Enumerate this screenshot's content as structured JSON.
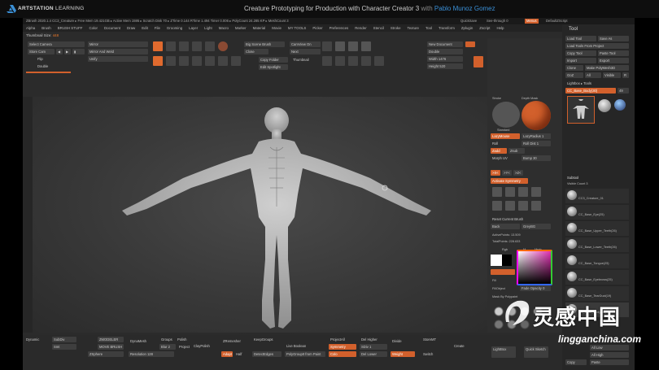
{
  "header": {
    "brand_bold": "ARTSTATION",
    "brand_rest": "LEARNING",
    "course_title": "Creature Prototyping for Production with Character Creator 3",
    "with": "with",
    "author": "Pablo Munoz Gomez"
  },
  "title_bar": {
    "info": "ZBrush 2020.1.4   CC3_Creature   ▸ Free Mem 19.421GB ▸ Active Mem 1595 ▸ Scratch Disk 70 ▸ ZTime 0.144 RTime 1.494 Timer 0.006 ▸ PolyCount 24.285 KP ▸ MeshCount 3",
    "quicksave": "QuickSave",
    "seethrough": "See-through  0",
    "menus": "Menus",
    "defaultzscript": "DefaultZScript"
  },
  "menu": [
    "Alpha",
    "Brush",
    "BRUSH STUFF",
    "Color",
    "Document",
    "Draw",
    "Edit",
    "File",
    "Grooming",
    "Layer",
    "Light",
    "Macro",
    "Marker",
    "Material",
    "Movie",
    "MY TOOLS",
    "Picker",
    "Preferences",
    "Render",
    "Stencil",
    "Stroke",
    "Texture",
    "Tool",
    "Transform",
    "Zplugin",
    "Zscript",
    "Help"
  ],
  "thumbnail": {
    "label": "Thumbnail Size:",
    "value": "448"
  },
  "top_left": {
    "select_camera": "Select Camera",
    "store_cam": "Store Cam",
    "flip": "Flip",
    "double": "Double",
    "mirror": "Mirror",
    "mirror_weld": "Mirror And Weld",
    "unify": "Unify"
  },
  "top_icons": {
    "edit": "Edit",
    "draw": "Draw",
    "move": "Move",
    "scale": "Scale",
    "rotate": "Rotate",
    "topo": "Topo",
    "polyf": "PolyF",
    "solo": "Solo",
    "bpr": "BPR",
    "lsym": "LSym",
    "sxyz": "XYZ",
    "frame": "Frame",
    "xpose": "Xpose",
    "local": "Local",
    "floor": "Floor"
  },
  "top_mid": {
    "big_scene": "Big Scene Brush",
    "close": "Close",
    "copy_folder": "Copy Folder",
    "edit_spotlight": "Edit Spotlight",
    "thumbnail": "Thumbnail",
    "cam_view": "CamView On",
    "next": "Next",
    "load_obj": "Load OBJ"
  },
  "doc": {
    "new_document": "New Document",
    "double": "Double",
    "width_label": "Width",
    "width": "1476",
    "height_label": "Height",
    "height": "520",
    "save": "Save",
    "projection": "Projection Master",
    "quick_render": "Quick Render Test",
    "bpr_label": "BPR",
    "render_sculpt": "Back To Sculpt",
    "repeat": "Repeat",
    "groups": "Groups By Materials"
  },
  "mid_panel": {
    "stroke": "Stroke",
    "depth_mask": "Depth Mask",
    "standard": "Standard",
    "lazy": "LazyMouse",
    "lazy_radius": "LazyRadius 1",
    "roll": "Roll",
    "roll_dist": "Roll Dist 1",
    "zadd": "Zadd",
    "zsub": "Zsub",
    "morph_uv": "Morph UV",
    "bump": "Bump 30",
    "activate_symmetry": "Activate Symmetry",
    "x": ">X<",
    "y": ">Y<",
    "z": ">Z<",
    "reset_brush": "Reset Current Brush",
    "back": "Back",
    "grey": "GreyBG",
    "active_points": "ActivePoints: 13.509",
    "total_points": "TotalPoints: 228.633",
    "rgb": "Rgb",
    "m": "M",
    "mrgb": "Mrgb",
    "fill": "Fill",
    "fill_object": "FillObject",
    "fade_opacity": "Fade Opacity 0",
    "mask_polypaint": "Mask By Polypaint"
  },
  "tool": {
    "title": "Tool",
    "load_tool": "Load Tool",
    "save_as": "Save As",
    "load_project": "Load Tools From Project",
    "copy_tool": "Copy Tool",
    "paste_tool": "Paste Tool",
    "import": "Import",
    "export": "Export",
    "clone": "Clone",
    "make_polymesh": "Make PolyMesh3D",
    "goz": "GoZ",
    "all": "All",
    "visible": "Visible",
    "r": "R",
    "lightbox": "Lightbox ▸ Tools",
    "current": "CC_Base_Body(30)",
    "count": "49",
    "subtool": "Subtool",
    "visible_count": "Visible Count 3",
    "items": [
      "CC3_Creature_01",
      "CC_Base_Eye(25)",
      "CC_Base_Upper_Teeth(26)",
      "CC_Base_Lower_Teeth(26)",
      "CC_Base_Tongue(25)",
      "CC_Base_Eyebrows(25)",
      "CC_Base_TearDuct(19)",
      "CC_Base_Body(30)"
    ],
    "bottom": {
      "all_low": "All Low",
      "all_high": "All High",
      "copy": "Copy",
      "paste": "Paste",
      "duplicate": "Duplicate",
      "append": "Append",
      "insert": "Insert"
    }
  },
  "bottom": {
    "dynamic": "Dynamic",
    "subdiv": "SubDiv",
    "smt": "Smt",
    "zmodeler": "ZMODELER",
    "move_brush": "MOVE BRUSH",
    "zsphere": "ZSphere",
    "dynamesh": "DynaMesh",
    "groups": "Groups",
    "polish": "Polish",
    "blur": "Blur",
    "blur_val": "2",
    "project": "Project",
    "resolution": "Resolution 128",
    "clay_polish": "ClayPolish",
    "zremesher": "ZRemesher",
    "keep_groups": "KeepGroups",
    "live_boolean": "Live Boolean",
    "project_all": "ProjectAll",
    "dist": "Dist",
    "mean": "Mean",
    "del_higher": "Del Higher",
    "divide": "Divide",
    "storemt": "StoreMT",
    "unset": "Unset",
    "create": "Create",
    "del_lower": "Del Lower",
    "sdiv": "SDiv 1",
    "adapt": "Adapt",
    "half": "Half",
    "detect_edges": "DetectEdges",
    "polygroup_paint": "PolyGroupIt from Paint",
    "symmetry": "Symmetry",
    "color": "Colo",
    "lightbox": "LightBox",
    "quick_sketch": "Quick Sketch",
    "switch": "Switch",
    "weight": "Weight"
  },
  "colors": {
    "accent": "#d2602c",
    "bg": "#2b2b2b",
    "viewport": "#3a3a3a"
  },
  "watermark": {
    "chinese": "灵感中国",
    "url": "lingganchina.com"
  }
}
